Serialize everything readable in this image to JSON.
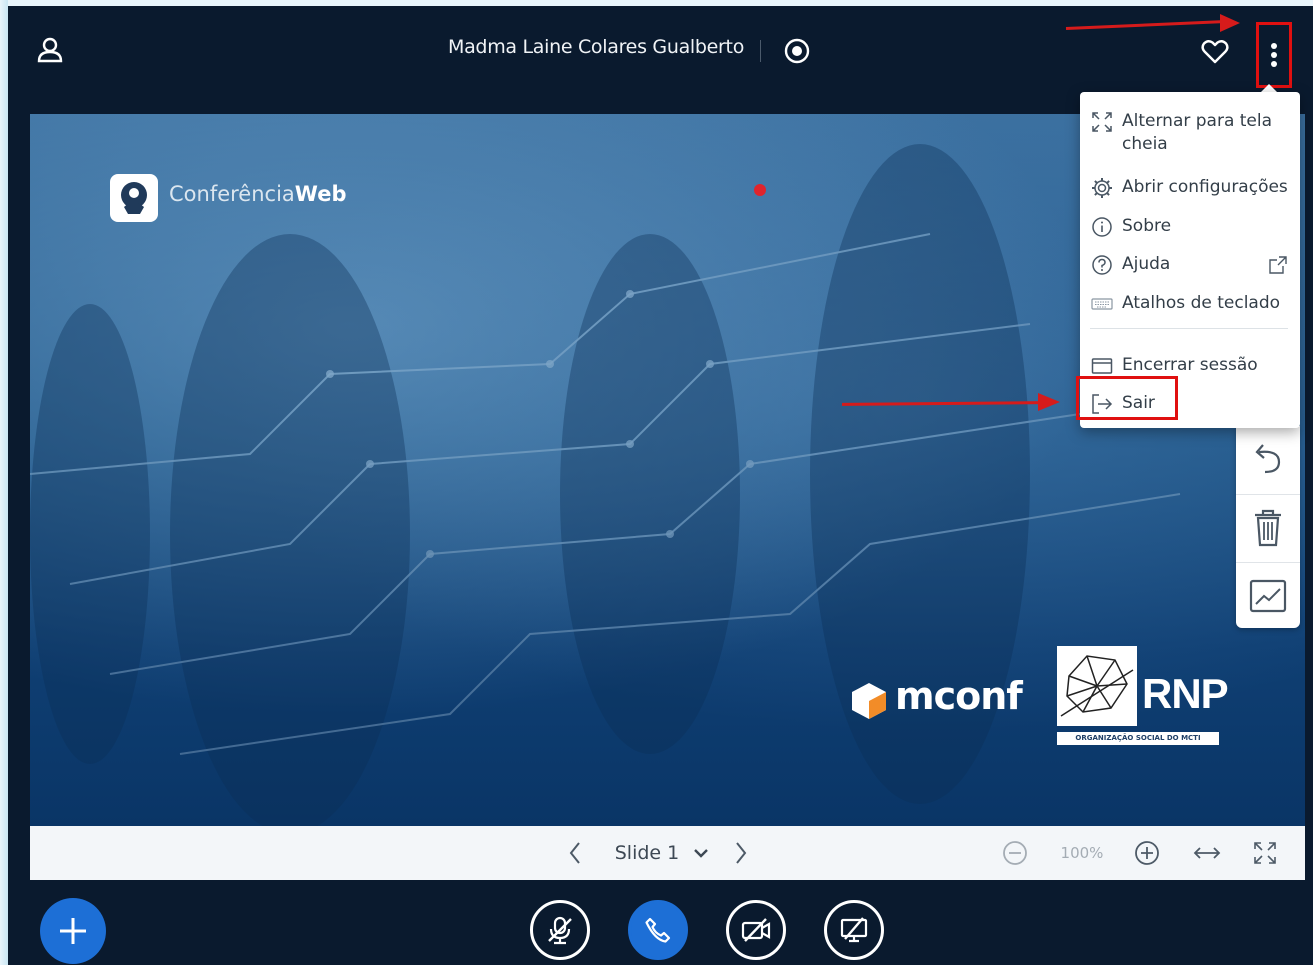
{
  "topbar": {
    "meeting_title": "Madma Laine Colares Gualberto",
    "icons": [
      "user-icon",
      "record-icon",
      "heart-icon",
      "more-vertical-icon"
    ]
  },
  "options_menu": {
    "items": [
      {
        "label": "Alternar para tela cheia",
        "icon": "fullscreen-icon"
      },
      {
        "label": "Abrir configurações",
        "icon": "gear-icon"
      },
      {
        "label": "Sobre",
        "icon": "info-icon"
      },
      {
        "label": "Ajuda",
        "icon": "help-icon"
      },
      {
        "label": "Atalhos de teclado",
        "icon": "keyboard-icon"
      },
      {
        "label": "Encerrar sessão",
        "icon": "end-session-icon"
      },
      {
        "label": "Sair",
        "icon": "logout-icon"
      }
    ]
  },
  "slide": {
    "brand_part1": "Conferência",
    "brand_part2": "Web",
    "mconf_label": "mconf",
    "rnp_label": "RNP",
    "rnp_subtitle": "ORGANIZAÇÃO SOCIAL DO MCTI"
  },
  "slide_toolbar": {
    "slide_label": "Slide 1",
    "zoom_level": "100%"
  },
  "colors": {
    "accent_blue": "#1d6fd6",
    "annotation_red": "#e01010",
    "background_dark": "#0a1a2e"
  }
}
